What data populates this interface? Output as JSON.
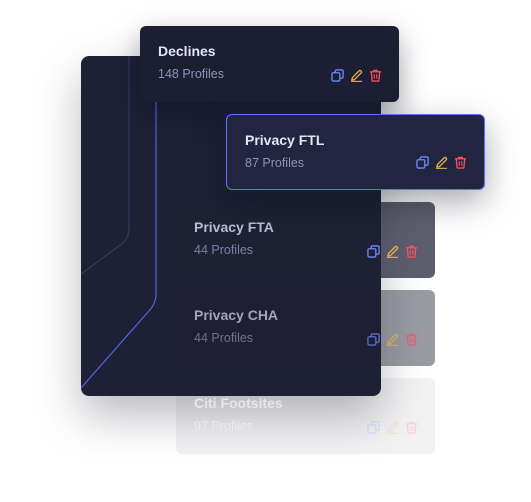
{
  "profile_groups": [
    {
      "name": "Declines",
      "count_label": "148 Profiles"
    },
    {
      "name": "Privacy FTL",
      "count_label": "87 Profiles"
    },
    {
      "name": "Privacy FTA",
      "count_label": "44 Profiles"
    },
    {
      "name": "Privacy CHA",
      "count_label": "44 Profiles"
    },
    {
      "name": "Citi Footsites",
      "count_label": "97 Profiles"
    }
  ],
  "colors": {
    "panel_bg": "#1e2035",
    "card_bg": "#1c1e33",
    "selected_border": "#5a72ff",
    "copy_icon": "#6b8cff",
    "edit_icon": "#e7b04a",
    "delete_icon": "#ff4d5e"
  },
  "icons": [
    "copy-icon",
    "edit-icon",
    "delete-icon"
  ]
}
